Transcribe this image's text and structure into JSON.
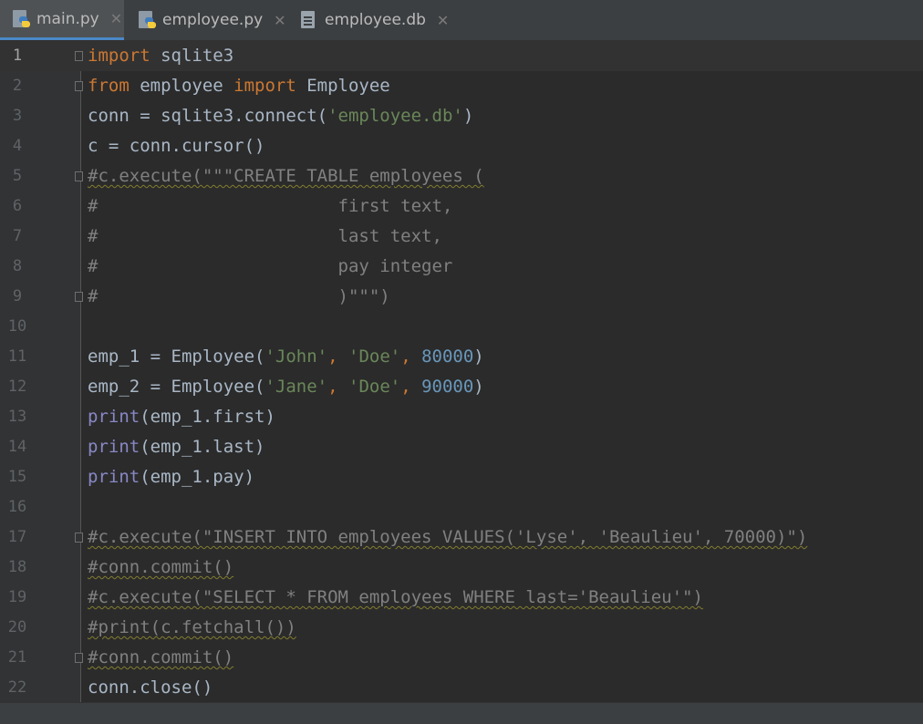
{
  "tabs": [
    {
      "label": "main.py",
      "icon": "python-file-icon",
      "active": true
    },
    {
      "label": "employee.py",
      "icon": "python-file-icon",
      "active": false
    },
    {
      "label": "employee.db",
      "icon": "database-file-icon",
      "active": false
    }
  ],
  "close_glyph": "✕",
  "line_numbers": [
    "1",
    "2",
    "3",
    "4",
    "5",
    "6",
    "7",
    "8",
    "9",
    "10",
    "11",
    "12",
    "13",
    "14",
    "15",
    "16",
    "17",
    "18",
    "19",
    "20",
    "21",
    "22"
  ],
  "code": {
    "l1_kw": "import",
    "l1_rest": " sqlite3",
    "l2_kw1": "from",
    "l2_mid": " employee ",
    "l2_kw2": "import",
    "l2_rest": " Employee",
    "l3_a": "conn = sqlite3.connect(",
    "l3_str": "'employee.db'",
    "l3_b": ")",
    "l4": "c = conn.cursor()",
    "l5": "#c.execute(\"\"\"CREATE TABLE employees (",
    "l6": "#                       first text,",
    "l7": "#                       last text,",
    "l8": "#                       pay integer",
    "l9": "#                       )\"\"\")",
    "l10": "",
    "l11_a": "emp_1 = Employee(",
    "l11_s1": "'John'",
    "l11_c1": ", ",
    "l11_s2": "'Doe'",
    "l11_c2": ", ",
    "l11_n": "80000",
    "l11_b": ")",
    "l12_a": "emp_2 = Employee(",
    "l12_s1": "'Jane'",
    "l12_c1": ", ",
    "l12_s2": "'Doe'",
    "l12_c2": ", ",
    "l12_n": "90000",
    "l12_b": ")",
    "l13_bi": "print",
    "l13_rest": "(emp_1.first)",
    "l14_bi": "print",
    "l14_rest": "(emp_1.last)",
    "l15_bi": "print",
    "l15_rest": "(emp_1.pay)",
    "l16": "",
    "l17": "#c.execute(\"INSERT INTO employees VALUES('Lyse', 'Beaulieu', 70000)\")",
    "l18": "#conn.commit()",
    "l19": "#c.execute(\"SELECT * FROM employees WHERE last='Beaulieu'\")",
    "l20": "#print(c.fetchall())",
    "l21": "#conn.commit()",
    "l22": "conn.close()"
  },
  "colors": {
    "keyword": "#cc7832",
    "string": "#6a8759",
    "number": "#6897bb",
    "builtin": "#8888c6",
    "comment": "#808080",
    "text": "#a9b7c6"
  }
}
